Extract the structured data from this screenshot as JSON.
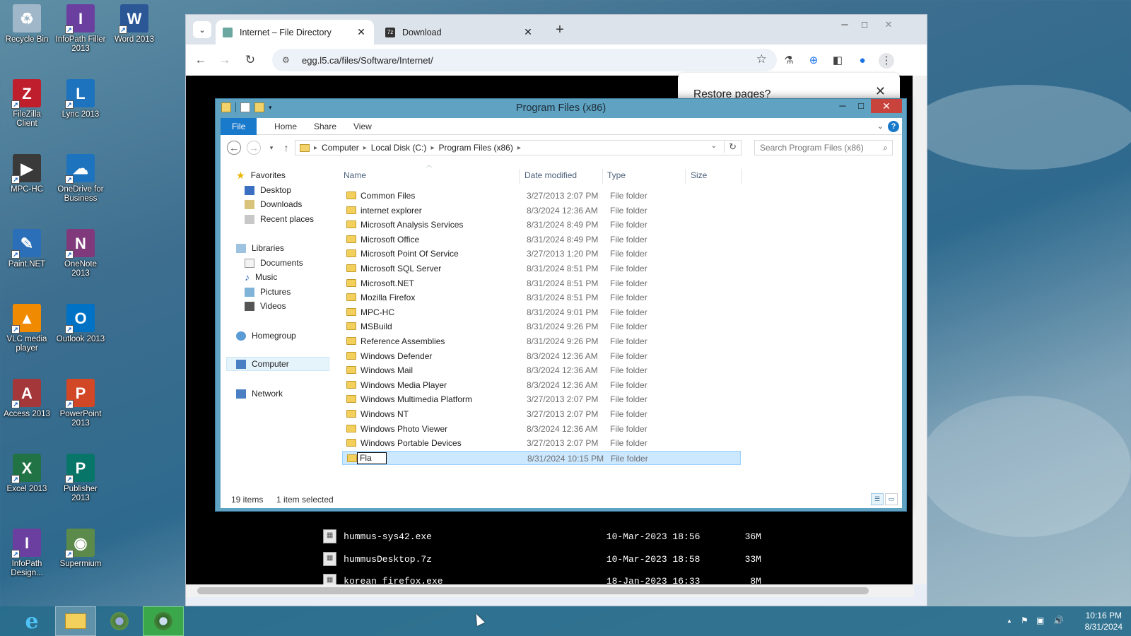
{
  "desktop": {
    "icons": [
      {
        "label": "Recycle Bin",
        "icon": "recycle-bin-icon",
        "color": "#9fb7c8"
      },
      {
        "label": "InfoPath Filler 2013",
        "icon": "infopath-icon",
        "color": "#6b3fa0"
      },
      {
        "label": "Word 2013",
        "icon": "word-icon",
        "color": "#2b5797"
      },
      {
        "label": "FileZilla Client",
        "icon": "filezilla-icon",
        "color": "#bf1e2d"
      },
      {
        "label": "Lync 2013",
        "icon": "lync-icon",
        "color": "#1e73be"
      },
      {
        "label": "MPC-HC",
        "icon": "mpc-hc-icon",
        "color": "#3a3a3a"
      },
      {
        "label": "OneDrive for Business",
        "icon": "onedrive-icon",
        "color": "#1e73be"
      },
      {
        "label": "Paint.NET",
        "icon": "paintnet-icon",
        "color": "#2a6fb8"
      },
      {
        "label": "OneNote 2013",
        "icon": "onenote-icon",
        "color": "#80397b"
      },
      {
        "label": "VLC media player",
        "icon": "vlc-icon",
        "color": "#f08a00"
      },
      {
        "label": "Outlook 2013",
        "icon": "outlook-icon",
        "color": "#0072c6"
      },
      {
        "label": "Access 2013",
        "icon": "access-icon",
        "color": "#a4373a"
      },
      {
        "label": "PowerPoint 2013",
        "icon": "powerpoint-icon",
        "color": "#d24726"
      },
      {
        "label": "Excel 2013",
        "icon": "excel-icon",
        "color": "#217346"
      },
      {
        "label": "Publisher 2013",
        "icon": "publisher-icon",
        "color": "#077568"
      },
      {
        "label": "InfoPath Design...",
        "icon": "infopath-designer-icon",
        "color": "#6b3fa0"
      },
      {
        "label": "Supermium",
        "icon": "supermium-icon",
        "color": "#5b8a4a"
      }
    ]
  },
  "browser": {
    "tabs": [
      {
        "title": "Internet – File Directory",
        "active": true
      },
      {
        "title": "Download",
        "active": false
      }
    ],
    "url": "egg.l5.ca/files/Software/Internet/",
    "restore_popup": "Restore pages?",
    "listing": [
      {
        "name": "hummus-sys42.exe",
        "date": "10-Mar-2023 18:56",
        "size": "36M"
      },
      {
        "name": "hummusDesktop.7z",
        "date": "10-Mar-2023 18:58",
        "size": "33M"
      },
      {
        "name": "korean firefox.exe",
        "date": "18-Jan-2023 16:33",
        "size": "8M"
      }
    ]
  },
  "explorer": {
    "title": "Program Files (x86)",
    "ribbon_tabs": [
      "File",
      "Home",
      "Share",
      "View"
    ],
    "breadcrumb": [
      "Computer",
      "Local Disk (C:)",
      "Program Files (x86)"
    ],
    "search_placeholder": "Search Program Files (x86)",
    "nav": {
      "favorites": "Favorites",
      "desktop": "Desktop",
      "downloads": "Downloads",
      "recent": "Recent places",
      "libraries": "Libraries",
      "documents": "Documents",
      "music": "Music",
      "pictures": "Pictures",
      "videos": "Videos",
      "homegroup": "Homegroup",
      "computer": "Computer",
      "network": "Network"
    },
    "columns": {
      "name": "Name",
      "date": "Date modified",
      "type": "Type",
      "size": "Size"
    },
    "rows": [
      {
        "name": "Common Files",
        "date": "3/27/2013 2:07 PM",
        "type": "File folder"
      },
      {
        "name": "internet explorer",
        "date": "8/3/2024 12:36 AM",
        "type": "File folder"
      },
      {
        "name": "Microsoft Analysis Services",
        "date": "8/31/2024 8:49 PM",
        "type": "File folder"
      },
      {
        "name": "Microsoft Office",
        "date": "8/31/2024 8:49 PM",
        "type": "File folder"
      },
      {
        "name": "Microsoft Point Of Service",
        "date": "3/27/2013 1:20 PM",
        "type": "File folder"
      },
      {
        "name": "Microsoft SQL Server",
        "date": "8/31/2024 8:51 PM",
        "type": "File folder"
      },
      {
        "name": "Microsoft.NET",
        "date": "8/31/2024 8:51 PM",
        "type": "File folder"
      },
      {
        "name": "Mozilla Firefox",
        "date": "8/31/2024 8:51 PM",
        "type": "File folder"
      },
      {
        "name": "MPC-HC",
        "date": "8/31/2024 9:01 PM",
        "type": "File folder"
      },
      {
        "name": "MSBuild",
        "date": "8/31/2024 9:26 PM",
        "type": "File folder"
      },
      {
        "name": "Reference Assemblies",
        "date": "8/31/2024 9:26 PM",
        "type": "File folder"
      },
      {
        "name": "Windows Defender",
        "date": "8/3/2024 12:36 AM",
        "type": "File folder"
      },
      {
        "name": "Windows Mail",
        "date": "8/3/2024 12:36 AM",
        "type": "File folder"
      },
      {
        "name": "Windows Media Player",
        "date": "8/3/2024 12:36 AM",
        "type": "File folder"
      },
      {
        "name": "Windows Multimedia Platform",
        "date": "3/27/2013 2:07 PM",
        "type": "File folder"
      },
      {
        "name": "Windows NT",
        "date": "3/27/2013 2:07 PM",
        "type": "File folder"
      },
      {
        "name": "Windows Photo Viewer",
        "date": "8/3/2024 12:36 AM",
        "type": "File folder"
      },
      {
        "name": "Windows Portable Devices",
        "date": "3/27/2013 2:07 PM",
        "type": "File folder"
      }
    ],
    "rename_row": {
      "value": "Fla",
      "date": "8/31/2024 10:15 PM",
      "type": "File folder"
    },
    "status": {
      "count": "19 items",
      "selected": "1 item selected"
    }
  },
  "taskbar": {
    "time": "10:16 PM",
    "date": "8/31/2024"
  }
}
